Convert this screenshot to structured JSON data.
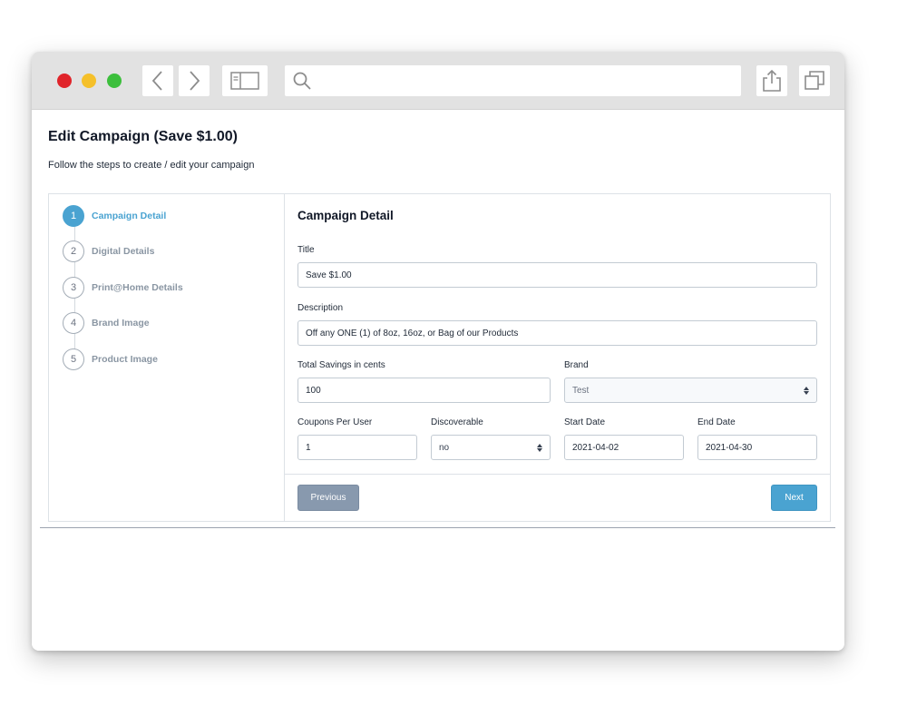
{
  "browser": {
    "address": "",
    "controls": {
      "back_icon": "chevron-left-icon",
      "forward_icon": "chevron-right-icon",
      "sidebar_icon": "sidebar-icon",
      "search_icon": "search-icon",
      "share_icon": "share-icon",
      "tabs_icon": "tabs-icon"
    },
    "colors": {
      "close": "#e0242a",
      "minimize": "#f5c02a",
      "maximize": "#3cbf3c"
    }
  },
  "page": {
    "title": "Edit Campaign (Save $1.00)",
    "subtitle": "Follow the steps to create / edit your campaign"
  },
  "steps": [
    {
      "number": "1",
      "label": "Campaign Detail",
      "active": true
    },
    {
      "number": "2",
      "label": "Digital Details",
      "active": false
    },
    {
      "number": "3",
      "label": "Print@Home Details",
      "active": false
    },
    {
      "number": "4",
      "label": "Brand Image",
      "active": false
    },
    {
      "number": "5",
      "label": "Product Image",
      "active": false
    }
  ],
  "form": {
    "heading": "Campaign Detail",
    "title": {
      "label": "Title",
      "value": "Save $1.00"
    },
    "description": {
      "label": "Description",
      "value": "Off any ONE (1) of 8oz, 16oz, or Bag of our Products"
    },
    "total_savings": {
      "label": "Total Savings in cents",
      "value": "100"
    },
    "brand": {
      "label": "Brand",
      "value": "Test"
    },
    "coupons_per_user": {
      "label": "Coupons Per User",
      "value": "1"
    },
    "discoverable": {
      "label": "Discoverable",
      "value": "no"
    },
    "start_date": {
      "label": "Start Date",
      "value": "2021-04-02"
    },
    "end_date": {
      "label": "End Date",
      "value": "2021-04-30"
    }
  },
  "actions": {
    "previous_label": "Previous",
    "next_label": "Next"
  },
  "colors": {
    "accent": "#4aa3d1",
    "previous_button": "#8899ae",
    "inactive_step": "#8a96a3"
  }
}
